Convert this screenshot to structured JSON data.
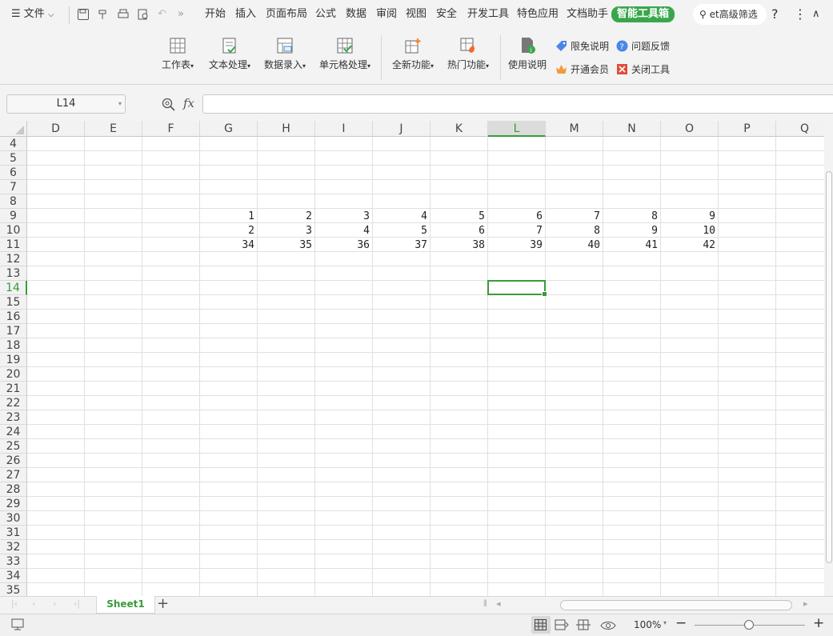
{
  "menubar": {
    "file": "文件",
    "tabs": [
      "开始",
      "插入",
      "页面布局",
      "公式",
      "数据",
      "审阅",
      "视图",
      "安全",
      "开发工具",
      "特色应用",
      "文档助手"
    ],
    "active_tab": "智能工具箱",
    "search": "et高级筛选",
    "help": "?",
    "more": "⋮",
    "collapse": "∧"
  },
  "ribbon": {
    "worksheet": "工作表",
    "text_processing": "文本处理",
    "data_entry": "数据录入",
    "cell_processing": "单元格处理",
    "all_new": "全新功能",
    "hot": "热门功能",
    "usage": "使用说明",
    "limited_free": "限免说明",
    "feedback": "问题反馈",
    "open_member": "开通会员",
    "close_tool": "关闭工具"
  },
  "formula": {
    "namebox": "L14",
    "fx": "fx",
    "value": ""
  },
  "columns": [
    "D",
    "E",
    "F",
    "G",
    "H",
    "I",
    "J",
    "K",
    "L",
    "M",
    "N",
    "O",
    "P",
    "Q"
  ],
  "selected_column": "L",
  "rows": [
    "4",
    "5",
    "6",
    "7",
    "8",
    "9",
    "10",
    "11",
    "12",
    "13",
    "14",
    "15",
    "16",
    "17",
    "18",
    "19",
    "20",
    "21",
    "22",
    "23",
    "24",
    "25",
    "26",
    "27",
    "28",
    "29",
    "30",
    "31",
    "32",
    "33",
    "34",
    "35"
  ],
  "selected_row": "14",
  "cells": {
    "row9": [
      "1",
      "2",
      "3",
      "4",
      "5",
      "6",
      "7",
      "8",
      "9"
    ],
    "row10": [
      "2",
      "3",
      "4",
      "5",
      "6",
      "7",
      "8",
      "9",
      "10"
    ],
    "row11": [
      "34",
      "35",
      "36",
      "37",
      "38",
      "39",
      "40",
      "41",
      "42"
    ]
  },
  "sheet": {
    "tab": "Sheet1",
    "add": "+"
  },
  "status": {
    "zoom": "100%",
    "minus": "−",
    "plus": "+"
  },
  "colors": {
    "accent": "#3aa64c",
    "grid": "#e0e0e0"
  }
}
